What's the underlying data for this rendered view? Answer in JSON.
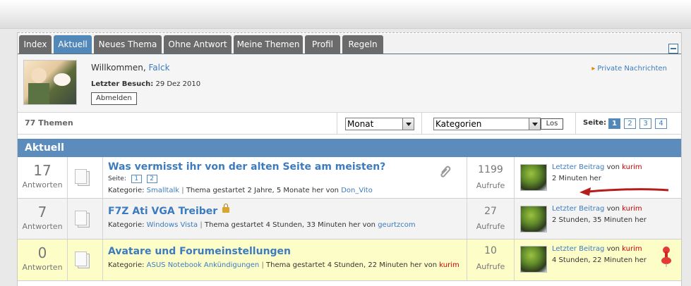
{
  "tabs": [
    {
      "label": "Index"
    },
    {
      "label": "Aktuell",
      "active": true
    },
    {
      "label": "Neues Thema"
    },
    {
      "label": "Ohne Antwort"
    },
    {
      "label": "Meine Themen"
    },
    {
      "label": "Profil"
    },
    {
      "label": "Regeln"
    }
  ],
  "user": {
    "welcome_prefix": "Willkommen,",
    "username": "Falck",
    "last_visit_label": "Letzter Besuch:",
    "last_visit_value": "29 Dez 2010",
    "logout_label": "Abmelden",
    "pm_label": "Private Nachrichten"
  },
  "filters": {
    "topic_count": "77 Themen",
    "period_selected": "Monat",
    "category_selected": "Kategorien",
    "go_label": "Los",
    "page_label": "Seite:",
    "pages": [
      "1",
      "2",
      "3",
      "4"
    ]
  },
  "section_title": "Aktuell",
  "rows": [
    {
      "replies": "17",
      "replies_label": "Antworten",
      "title": "Was vermisst ihr von der alten Seite am meisten?",
      "pages_label": "Seite:",
      "pages": [
        "1",
        "2"
      ],
      "category_label": "Kategorie:",
      "category": "Smalltalk",
      "started": "Thema gestartet 2 Jahre, 5 Monate her von",
      "author": "Don_Vito",
      "views": "1199",
      "views_label": "Aufrufe",
      "last_post_label": "Letzter Beitrag",
      "von": "von",
      "last_user": "kurim",
      "last_time": "2 Minuten her"
    },
    {
      "replies": "7",
      "replies_label": "Antworten",
      "title": "F7Z Ati VGA Treiber",
      "category_label": "Kategorie:",
      "category": "Windows Vista",
      "started": "Thema gestartet 4 Stunden, 33 Minuten her von",
      "author": "geurtzcom",
      "views": "27",
      "views_label": "Aufrufe",
      "last_post_label": "Letzter Beitrag",
      "von": "von",
      "last_user": "kurim",
      "last_time": "2 Stunden, 35 Minuten her"
    },
    {
      "replies": "0",
      "replies_label": "Antworten",
      "title": "Avatare und Forumeinstellungen",
      "category_label": "Kategorie:",
      "category": "ASUS Notebook Ankündigungen",
      "started": "Thema gestartet 4 Stunden, 22 Minuten her von",
      "author": "kurim",
      "views": "10",
      "views_label": "Aufrufe",
      "last_post_label": "Letzter Beitrag",
      "von": "von",
      "last_user": "kurim",
      "last_time": "4 Stunden, 22 Minuten her"
    }
  ],
  "colors": {
    "accent": "#5288b8",
    "link": "#3c7bbf",
    "sticky_row": "#fdfdc8",
    "alt_row": "#f3f3f3",
    "highlight_user": "#cc0000"
  }
}
